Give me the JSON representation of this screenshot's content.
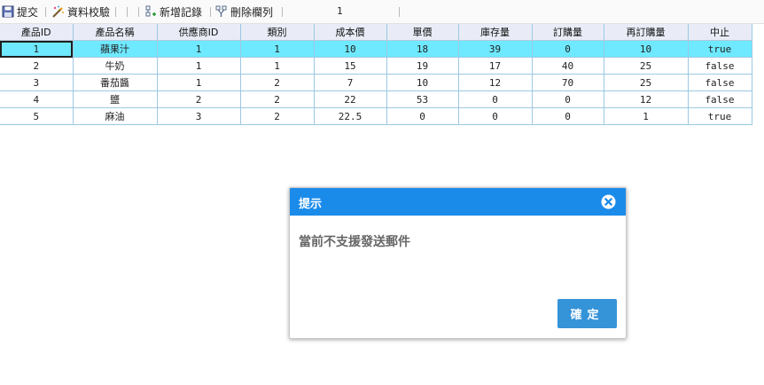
{
  "toolbar": {
    "submit_label": "提交",
    "validate_label": "資料校驗",
    "add_record_label": "新增記錄",
    "delete_column_label": "刪除欄列",
    "page_indicator": "1"
  },
  "grid": {
    "columns": [
      "產品ID",
      "產品名稱",
      "供應商ID",
      "類別",
      "成本價",
      "單價",
      "庫存量",
      "訂購量",
      "再訂購量",
      "中止"
    ],
    "rows": [
      [
        "1",
        "蘋果汁",
        "1",
        "1",
        "10",
        "18",
        "39",
        "0",
        "10",
        "true"
      ],
      [
        "2",
        "牛奶",
        "1",
        "1",
        "15",
        "19",
        "17",
        "40",
        "25",
        "false"
      ],
      [
        "3",
        "番茄醬",
        "1",
        "2",
        "7",
        "10",
        "12",
        "70",
        "25",
        "false"
      ],
      [
        "4",
        "鹽",
        "2",
        "2",
        "22",
        "53",
        "0",
        "0",
        "12",
        "false"
      ],
      [
        "5",
        "麻油",
        "3",
        "2",
        "22.5",
        "0",
        "0",
        "0",
        "1",
        "true"
      ]
    ],
    "selected_row_index": 0,
    "selected_row_color": "#6ee9ff"
  },
  "dialog": {
    "title": "提示",
    "message": "當前不支援發送郵件",
    "ok_label": "確定",
    "header_color": "#1b8bea",
    "button_color": "#3593d8",
    "close_icon": "close-circle-icon"
  }
}
